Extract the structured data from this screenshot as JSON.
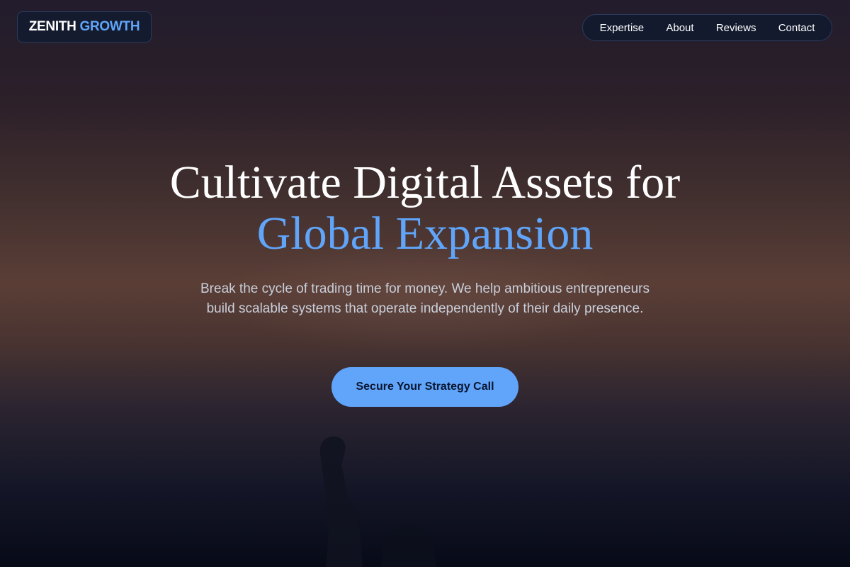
{
  "brand": {
    "word1": "ZENITH",
    "word2": "GROWTH"
  },
  "nav": {
    "items": [
      {
        "label": "Expertise"
      },
      {
        "label": "About"
      },
      {
        "label": "Reviews"
      },
      {
        "label": "Contact"
      }
    ]
  },
  "hero": {
    "headline_line1": "Cultivate Digital Assets for",
    "headline_line2": "Global Expansion",
    "subtitle": "Break the cycle of trading time for money. We help ambitious entrepreneurs build scalable systems that operate independently of their daily presence.",
    "cta_label": "Secure Your Strategy Call"
  },
  "colors": {
    "accent": "#60a5fa",
    "background_dark": "#070a17",
    "nav_bg": "#131a2e"
  }
}
